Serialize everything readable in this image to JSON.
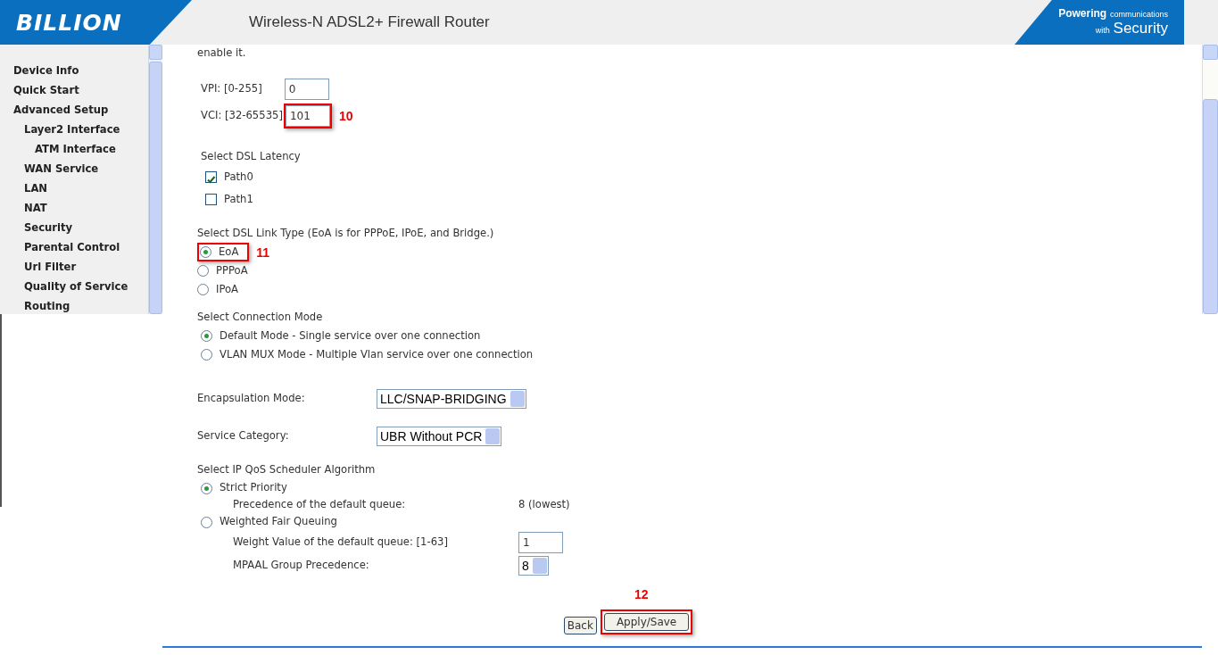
{
  "header": {
    "logo": "BILLION",
    "title": "Wireless-N ADSL2+ Firewall Router",
    "slogan_line1_bold": "Powering",
    "slogan_line1": "communications",
    "slogan_line2_small": "with",
    "slogan_line2_big": "Security"
  },
  "sidebar": {
    "items": [
      {
        "label": "Device Info"
      },
      {
        "label": "Quick Start"
      },
      {
        "label": "Advanced Setup",
        "children": [
          {
            "label": "Layer2 Interface",
            "children": [
              {
                "label": "ATM Interface"
              }
            ]
          },
          {
            "label": "WAN Service"
          },
          {
            "label": "LAN"
          },
          {
            "label": "NAT"
          },
          {
            "label": "Security"
          },
          {
            "label": "Parental Control"
          },
          {
            "label": "Url Filter"
          },
          {
            "label": "Quality of Service"
          },
          {
            "label": "Routing"
          }
        ]
      }
    ]
  },
  "form": {
    "intro": "enable it.",
    "vpi": {
      "label": "VPI: [0-255]",
      "value": "0"
    },
    "vci": {
      "label": "VCI: [32-65535]",
      "value": "101",
      "callout": "10"
    },
    "latency": {
      "title": "Select DSL Latency",
      "options": [
        {
          "label": "Path0",
          "checked": true
        },
        {
          "label": "Path1",
          "checked": false
        }
      ]
    },
    "link_type": {
      "title": "Select DSL Link Type (EoA is for PPPoE, IPoE, and Bridge.)",
      "options": [
        {
          "label": "EoA",
          "selected": true,
          "callout": "11"
        },
        {
          "label": "PPPoA",
          "selected": false
        },
        {
          "label": "IPoA",
          "selected": false
        }
      ]
    },
    "connection_mode": {
      "title": "Select Connection Mode",
      "options": [
        {
          "label": "Default Mode - Single service over one connection",
          "selected": true
        },
        {
          "label": "VLAN MUX Mode - Multiple Vlan service over one connection",
          "selected": false
        }
      ]
    },
    "encapsulation": {
      "label": "Encapsulation Mode:",
      "value": "LLC/SNAP-BRIDGING"
    },
    "service_category": {
      "label": "Service Category:",
      "value": "UBR Without PCR"
    },
    "qos": {
      "title": "Select IP QoS Scheduler Algorithm",
      "options": [
        {
          "label": "Strict Priority",
          "selected": true,
          "fields": [
            {
              "kind": "text",
              "label": "Precedence of the default queue:",
              "value": "8 (lowest)"
            }
          ]
        },
        {
          "label": "Weighted Fair Queuing",
          "selected": false,
          "fields": [
            {
              "kind": "input",
              "label": "Weight Value of the default queue: [1-63]",
              "value": "1"
            },
            {
              "kind": "select",
              "label": "MPAAL Group Precedence:",
              "value": "8"
            }
          ]
        }
      ]
    }
  },
  "buttons": [
    {
      "label": "Back"
    },
    {
      "label": "Apply/Save",
      "callout": "12"
    }
  ]
}
